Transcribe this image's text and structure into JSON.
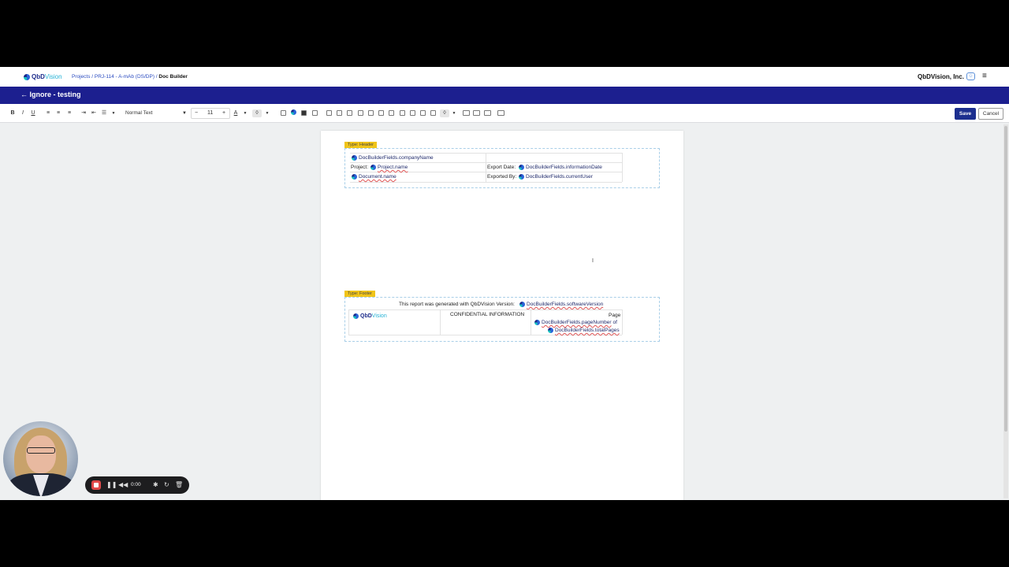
{
  "nav": {
    "logo_qbd": "QbD",
    "logo_vision": "Vision",
    "breadcrumb_projects": "Projects",
    "breadcrumb_sep1": " / ",
    "breadcrumb_project": "PRJ-114 - A-mAb (DS/DP)",
    "breadcrumb_sep2": " / ",
    "breadcrumb_current": "Doc Builder",
    "company": "QbDVision, Inc."
  },
  "titlebar": {
    "back_label": "← Ignore - testing"
  },
  "toolbar": {
    "bold": "B",
    "italic": "I",
    "underline": "U",
    "text_style": "Normal Text",
    "font_size_minus": "−",
    "font_size": "11",
    "font_size_plus": "+",
    "font_color": "A",
    "save_label": "Save",
    "cancel_label": "Cancel"
  },
  "header_section": {
    "type_label": "Type: Header",
    "company_field": "DocBuilderFields.companyName",
    "project_label": "Project:",
    "project_field": "Project.name",
    "export_date_label": "Export Date:",
    "export_date_field": "DocBuilderFields.informationDate",
    "document_field": "Document.name",
    "exported_by_label": "Exported By:",
    "exported_by_field": "DocBuilderFields.currentUser"
  },
  "footer_section": {
    "type_label": "Type: Footer",
    "generated_text": "This report was generated with QbDVision Version:",
    "version_field": "DocBuilderFields.softwareVersion",
    "logo_qbd": "QbD",
    "logo_vision": "Vision",
    "confidential": "CONFIDENTIAL INFORMATION",
    "page_label": "Page",
    "page_number_field": "DocBuilderFields.pageNumber",
    "of_label": "of",
    "total_pages_field": "DocBuilderFields.totalPages"
  },
  "recorder": {
    "time": "0:00"
  },
  "colors": {
    "brand_navy": "#1c1f8f",
    "save_button": "#1c2f8f",
    "type_tag": "#f0c419",
    "record_red": "#e04848"
  }
}
